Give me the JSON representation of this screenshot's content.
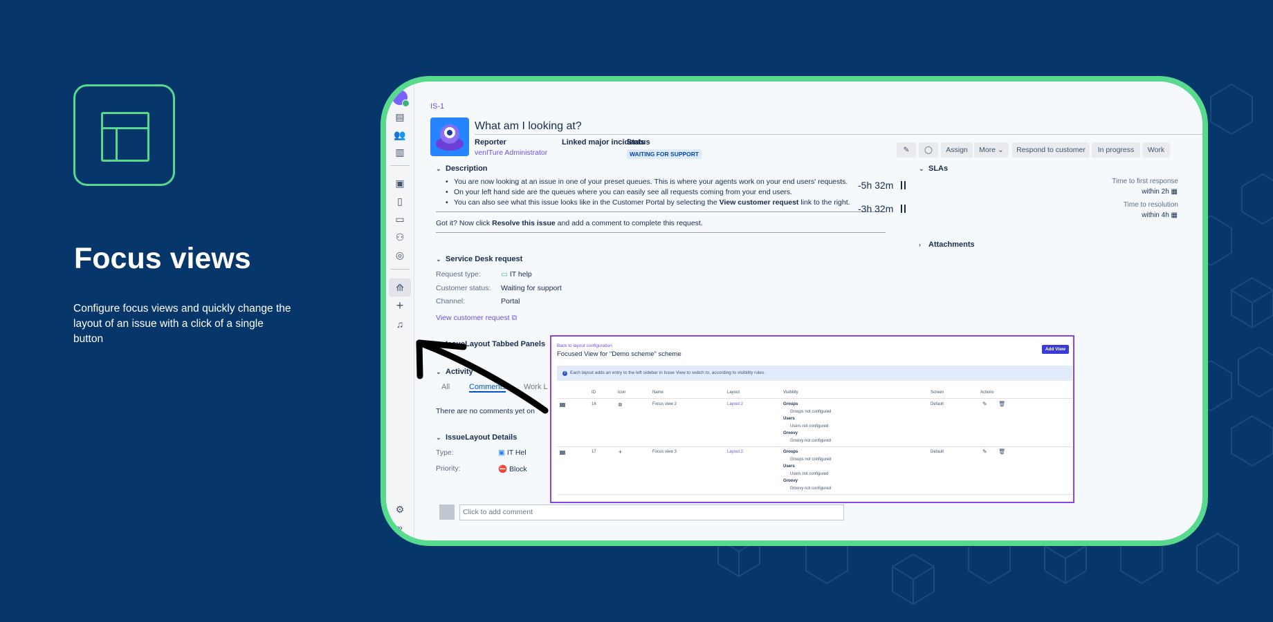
{
  "promo": {
    "icon": "layout-icon",
    "title": "Focus views",
    "description": "Configure focus views and quickly change the layout of an issue with a click of a single button"
  },
  "colors": {
    "background": "#06366a",
    "accent": "#57d98e",
    "overlay_border": "#8b44e8",
    "link": "#6b4ee6"
  },
  "issue": {
    "key": "IS-1",
    "title": "What am I looking at?",
    "reporter_label": "Reporter",
    "reporter_value": "venITure Administrator",
    "linked_label": "Linked major incidents",
    "status_label": "Status",
    "status_value": "WAITING FOR SUPPORT"
  },
  "toolbar": {
    "edit_icon": "pencil-icon",
    "comment_icon": "comment-icon",
    "assign": "Assign",
    "more": "More",
    "respond": "Respond to customer",
    "in_progress": "In progress",
    "work": "Work"
  },
  "description": {
    "heading": "Description",
    "bullets": [
      "You are now looking at an issue in one of your preset queues. This is where your agents work on your end users' requests.",
      "On your left hand side are the queues where you can easily see all requests coming from your end users."
    ],
    "bullet3_pre": "You can also see what this issue looks like in the Customer Portal by selecting the ",
    "bullet3_bold": "View customer request",
    "bullet3_post": " link to the right.",
    "gotit_pre": "Got it? Now click ",
    "gotit_bold": "Resolve this issue",
    "gotit_post": " and add a comment to complete this request."
  },
  "sla": {
    "heading": "SLAs",
    "items": [
      {
        "time": "-5h 32m",
        "label": "Time to first response",
        "within": "within 2h"
      },
      {
        "time": "-3h 32m",
        "label": "Time to resolution",
        "within": "within 4h"
      }
    ]
  },
  "attachments": {
    "heading": "Attachments"
  },
  "service_desk": {
    "heading": "Service Desk request",
    "fields": [
      {
        "label": "Request type:",
        "value": "IT help"
      },
      {
        "label": "Customer status:",
        "value": "Waiting for support"
      },
      {
        "label": "Channel:",
        "value": "Portal"
      }
    ],
    "view_link": "View customer request"
  },
  "tabbed_panels": {
    "heading": "IssueLayout Tabbed Panels"
  },
  "activity": {
    "heading": "Activity",
    "tabs": [
      "All",
      "Comments",
      "Work L"
    ],
    "empty": "There are no comments yet on"
  },
  "issue_layout_details": {
    "heading": "IssueLayout Details",
    "fields": [
      {
        "label": "Type:",
        "value": "IT Hel"
      },
      {
        "label": "Priority:",
        "value": "Block"
      }
    ]
  },
  "comment": {
    "placeholder": "Click to add comment"
  },
  "focused_view": {
    "back_link": "Back to layout configuration",
    "title": "Focused View for \"Demo scheme\" scheme",
    "add_button": "Add View",
    "info": "Each layout adds an entry to the left sidebar in Issue View to switch to, according to visibility rules.",
    "columns": [
      "ID",
      "Icon",
      "Name",
      "Layout",
      "Visibility",
      "Screen",
      "Actions"
    ],
    "rows": [
      {
        "id": "16",
        "icon": "x-circle-icon",
        "name": "Focus view 2",
        "layout": "Layout 2",
        "screen": "Default",
        "visibility": [
          "Groups",
          "Groups not configured",
          "Users",
          "Users not configured",
          "Groovy",
          "Groovy not configured"
        ]
      },
      {
        "id": "17",
        "icon": "plus-icon",
        "name": "Focus view 3",
        "layout": "Layout 2",
        "screen": "Default",
        "visibility": [
          "Groups",
          "Groups not configured",
          "Users",
          "Users not configured",
          "Groovy",
          "Groovy not configured"
        ]
      }
    ]
  }
}
